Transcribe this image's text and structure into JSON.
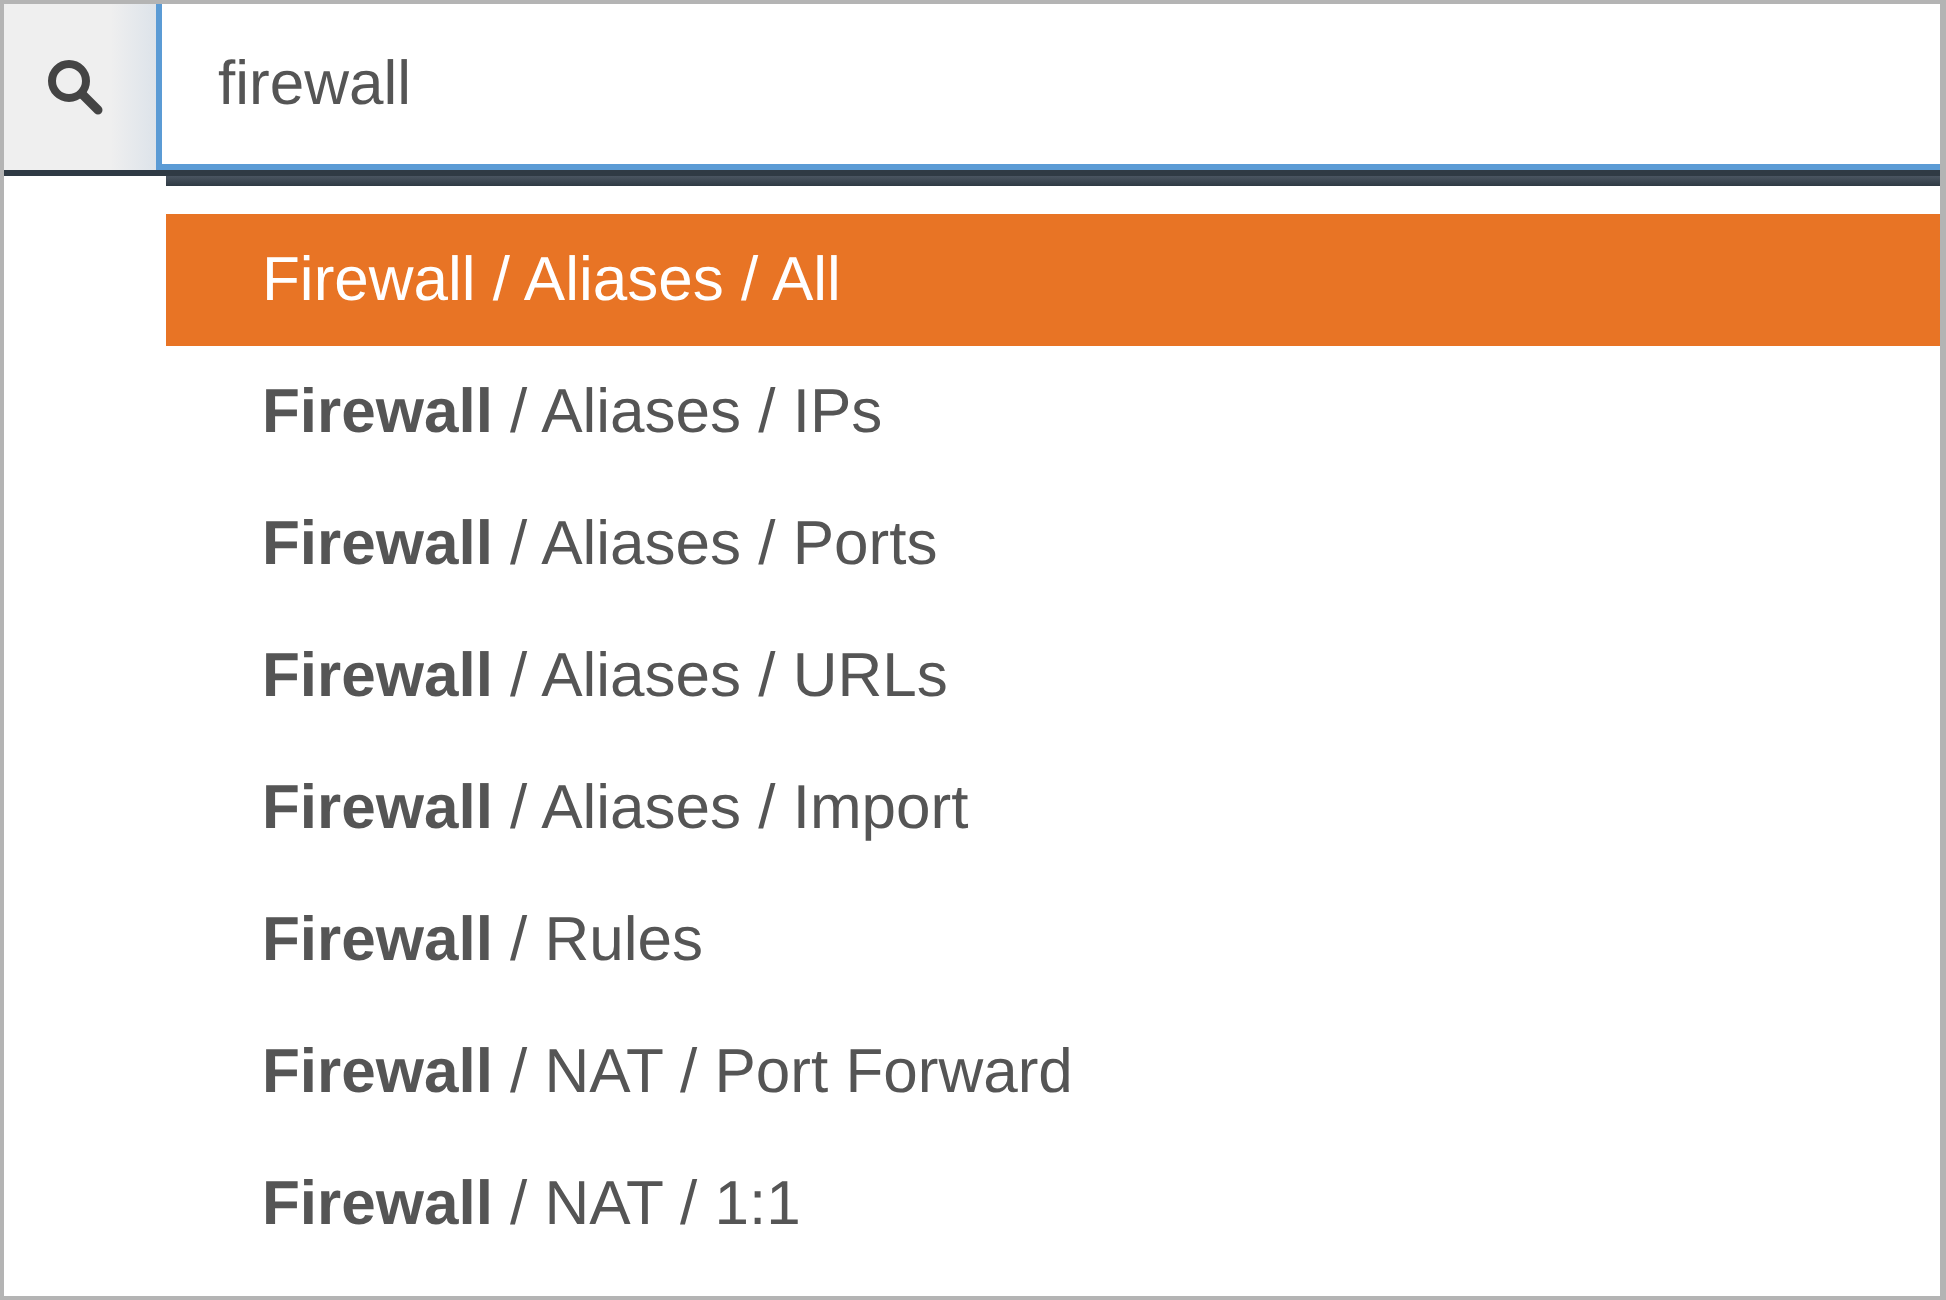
{
  "search": {
    "value": "firewall"
  },
  "suggestions": [
    {
      "label": "Firewall / Aliases / All",
      "selected": true
    },
    {
      "label": "**Firewall** / Aliases / IPs",
      "selected": false
    },
    {
      "label": "**Firewall** / Aliases / Ports",
      "selected": false
    },
    {
      "label": "**Firewall** / Aliases / URLs",
      "selected": false
    },
    {
      "label": "**Firewall** / Aliases / Import",
      "selected": false
    },
    {
      "label": "**Firewall** / Rules",
      "selected": false
    },
    {
      "label": "**Firewall** / NAT / Port Forward",
      "selected": false
    },
    {
      "label": "**Firewall** / NAT / 1:1",
      "selected": false
    }
  ]
}
